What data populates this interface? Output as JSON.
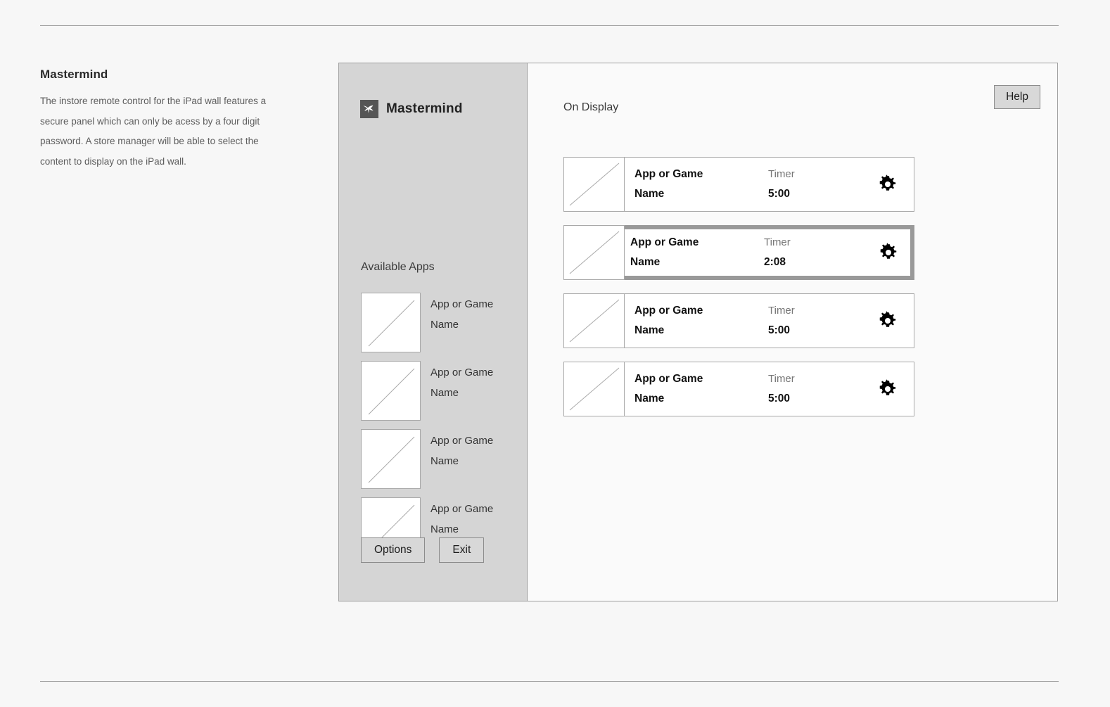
{
  "page": {
    "description_title": "Mastermind",
    "description_body": "The instore remote control for the iPad wall features a secure panel which can only be acess by a four digit password. A store manager will be able to select the content to display on the iPad wall."
  },
  "sidebar": {
    "brand_name": "Mastermind",
    "brand_icon": "puma-logo-icon",
    "available_apps_heading": "Available Apps",
    "apps": [
      {
        "label": "App or Game Name",
        "thumbnail": "placeholder-thumbnail-icon"
      },
      {
        "label": "App or Game Name",
        "thumbnail": "placeholder-thumbnail-icon"
      },
      {
        "label": "App or Game Name",
        "thumbnail": "placeholder-thumbnail-icon"
      },
      {
        "label": "App or Game Name",
        "thumbnail": "placeholder-thumbnail-icon"
      }
    ],
    "options_label": "Options",
    "exit_label": "Exit"
  },
  "main": {
    "on_display_heading": "On Display",
    "help_label": "Help",
    "rows": [
      {
        "name": "App or Game Name",
        "timer_label": "Timer",
        "timer_value": "5:00",
        "selected": false,
        "gear_icon": "gear-icon"
      },
      {
        "name": "App or Game Name",
        "timer_label": "Timer",
        "timer_value": "2:08",
        "selected": true,
        "gear_icon": "gear-icon"
      },
      {
        "name": "App or Game Name",
        "timer_label": "Timer",
        "timer_value": "5:00",
        "selected": false,
        "gear_icon": "gear-icon"
      },
      {
        "name": "App or Game Name",
        "timer_label": "Timer",
        "timer_value": "5:00",
        "selected": false,
        "gear_icon": "gear-icon"
      }
    ]
  },
  "colors": {
    "page_background": "#f7f7f7",
    "sidebar_background": "#d5d5d5",
    "panel_border": "#a0a0a0",
    "selection_border": "#999999",
    "brand_mark": "#555555",
    "rule": "#9a9a9a"
  }
}
